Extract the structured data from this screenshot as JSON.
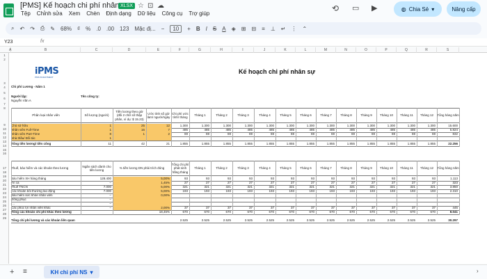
{
  "app": {
    "title": "[PMS] Kế hoạch chi phí nhân sự",
    "badge": "XLSX",
    "menu": [
      "Tệp",
      "Chỉnh sửa",
      "Xem",
      "Chèn",
      "Định dạng",
      "Dữ liệu",
      "Công cụ",
      "Trợ giúp"
    ],
    "share_label": "Chia Sẻ",
    "upgrade_label": "Nâng cấp"
  },
  "toolbar": {
    "zoom": "68%",
    "currency": "₫",
    "percent": "%",
    "dec_less": ".0",
    "dec_more": ".00",
    "num_format": "123",
    "font": "Mặc đị...",
    "font_size": "10",
    "bold": "B",
    "italic": "I",
    "strike": "S",
    "text_color": "A"
  },
  "formula_bar": {
    "cell_ref": "Y23",
    "fx": "fx"
  },
  "columns": [
    "A",
    "B",
    "C",
    "D",
    "E",
    "F",
    "G",
    "H",
    "I",
    "J",
    "K",
    "L",
    "M",
    "N",
    "O",
    "P",
    "Q",
    "R",
    "S"
  ],
  "sheet": {
    "title": "Kế hoạch chi phí nhân sự",
    "logo_text": "iPMS",
    "logo_sub": "PMS INVESTMENT",
    "subtitle": "Chi phí Lương - Năm 1",
    "prepared_by_label": "Người lập:",
    "prepared_by": "Nguyễn Văn A",
    "company_label": "Tên công ty:",
    "section1": {
      "headers": [
        "Phân loại nhân viên",
        "Số lượng (người)",
        "Tiền lương theo giờ (đối 2 chữ số thập phân, ví dụ: $ 15.23)",
        "Ước tính số giờ làm/ người/ngày",
        "Chi phí ước tính/ tháng",
        "Tháng 1",
        "Tháng 2",
        "Tháng 3",
        "Tháng 4",
        "Tháng 5",
        "Tháng 6",
        "Tháng 7",
        "Tháng 8",
        "Tháng 9",
        "Tháng 10",
        "Tháng 11",
        "Tháng 12",
        "Tổng hàng năm"
      ],
      "rows": [
        {
          "label": "Chủ sở hữu",
          "qty": "1",
          "wage": "25",
          "hours": "12",
          "est": "1.300",
          "months": [
            "1.300",
            "1.300",
            "1.300",
            "1.300",
            "1.300",
            "1.300",
            "1.300",
            "1.300",
            "1.300",
            "1.300",
            "1.300",
            "1.300"
          ],
          "total": "15.600"
        },
        {
          "label": "Nhân viên Full-Time",
          "qty": "1",
          "wage": "16",
          "hours": "7",
          "est": "485",
          "months": [
            "485",
            "485",
            "485",
            "485",
            "485",
            "485",
            "485",
            "485",
            "485",
            "485",
            "485",
            "485"
          ],
          "total": "5.824"
        },
        {
          "label": "Nhân viên Part-Time",
          "qty": "8",
          "wage": "1",
          "hours": "2",
          "est": "69",
          "months": [
            "69",
            "69",
            "69",
            "69",
            "69",
            "69",
            "69",
            "69",
            "69",
            "69",
            "69",
            "69"
          ],
          "total": "832"
        },
        {
          "label": "Nhà thầu/ Đối tác",
          "qty": "1",
          "wage": "",
          "hours": "",
          "est": "",
          "months": [
            "",
            "",
            "",
            "",
            "",
            "",
            "",
            "",
            "",
            "",
            "",
            ""
          ],
          "total": ""
        }
      ],
      "total": {
        "label": "Tổng tiền lương/ tiền công",
        "qty": "11",
        "wage": "42",
        "hours": "21",
        "est": "1.855",
        "months": [
          "1.855",
          "1.855",
          "1.855",
          "1.855",
          "1.855",
          "1.855",
          "1.855",
          "1.855",
          "1.855",
          "1.855",
          "1.855",
          "1.855"
        ],
        "total": "22.256"
      }
    },
    "section2": {
      "headers": [
        "Thuế, bảo hiểm và các khoản theo lương",
        "Ngân sách dành cho tiền lương",
        "% tiền lương DN phải trích đóng",
        "Tổng chi phí phát sinh hằng tháng",
        "Tháng 1",
        "Tháng 2",
        "Tháng 3",
        "Tháng 4",
        "Tháng 5",
        "Tháng 6",
        "Tháng 7",
        "Tháng 8",
        "Tháng 9",
        "Tháng 10",
        "Tháng 11",
        "Tháng 12",
        "Tổng hàng năm"
      ],
      "rows": [
        {
          "label": "Bảo hiểm XH hàng tháng",
          "budget": "128.400",
          "pct": "5,00%",
          "est": "93",
          "months": [
            "93",
            "93",
            "93",
            "93",
            "93",
            "93",
            "93",
            "93",
            "93",
            "93",
            "93",
            "93"
          ],
          "total": "1.113"
        },
        {
          "label": "Ăn ca",
          "budget": "–",
          "pct": "1,45%",
          "est": "27",
          "months": [
            "27",
            "27",
            "27",
            "27",
            "27",
            "27",
            "27",
            "27",
            "27",
            "27",
            "27",
            "27"
          ],
          "total": "323"
        },
        {
          "label": "Thuế TNCN",
          "budget": "7.000",
          "pct": "5,00%",
          "est": "321",
          "months": [
            "321",
            "321",
            "321",
            "321",
            "321",
            "321",
            "321",
            "321",
            "321",
            "321",
            "321",
            "321"
          ],
          "total": "3.850"
        },
        {
          "label": "Các khoản bồi thường lao động",
          "budget": "7.000",
          "pct": "5,00%",
          "est": "193",
          "months": [
            "193",
            "193",
            "193",
            "193",
            "193",
            "193",
            "193",
            "193",
            "193",
            "193",
            "193",
            "193"
          ],
          "total": "2.310"
        },
        {
          "label": "Bảo hiểm sức khỏe nhân viên",
          "budget": "–",
          "pct": "0,00%",
          "est": "",
          "months": [
            "",
            "",
            "",
            "",
            "",
            "",
            "",
            "",
            "",
            "",
            "",
            ""
          ],
          "total": ""
        },
        {
          "label": "Đồng phục",
          "budget": "–",
          "pct": "",
          "est": "",
          "months": [
            "",
            "",
            "",
            "",
            "",
            "",
            "",
            "",
            "",
            "",
            "",
            ""
          ],
          "total": ""
        },
        {
          "label": "....",
          "budget": "–",
          "pct": "",
          "est": "",
          "months": [
            "",
            "",
            "",
            "",
            "",
            "",
            "",
            "",
            "",
            "",
            "",
            ""
          ],
          "total": ""
        },
        {
          "label": "Các phúc lợi nhân viên khác",
          "budget": "–",
          "pct": "2,00%",
          "est": "37",
          "months": [
            "37",
            "37",
            "37",
            "37",
            "37",
            "37",
            "37",
            "37",
            "37",
            "37",
            "37",
            "37"
          ],
          "total": "445"
        }
      ],
      "total": {
        "label": "Tổng các khoản chi phí khác theo lương",
        "budget": "",
        "pct": "18,45%",
        "est": "670",
        "months": [
          "670",
          "670",
          "670",
          "670",
          "670",
          "670",
          "670",
          "670",
          "670",
          "670",
          "670",
          "670"
        ],
        "total": "8.041"
      },
      "grand": {
        "label": "Tổng chi phí lương và các khoản liên quan",
        "est": "2.525",
        "months": [
          "2.525",
          "2.525",
          "2.525",
          "2.525",
          "2.525",
          "2.525",
          "2.525",
          "2.525",
          "2.525",
          "2.525",
          "2.525",
          "2.525"
        ],
        "total": "30.297"
      }
    }
  },
  "tabs": {
    "active": "KH chi phí NS",
    "add_icon": "+",
    "list_icon": "≡"
  }
}
